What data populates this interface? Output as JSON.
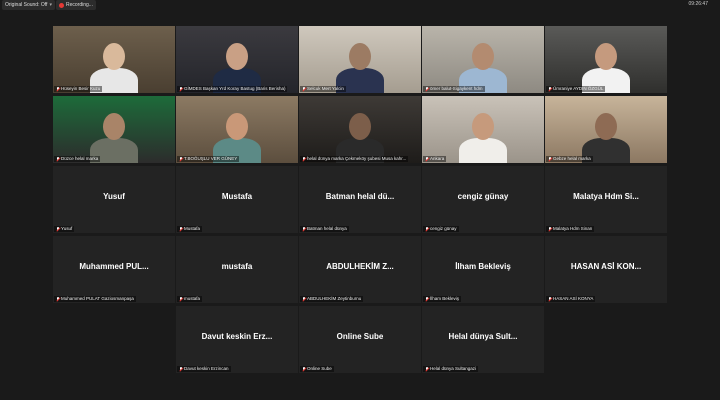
{
  "topbar": {
    "sound_label": "Original Sound: Off",
    "recording_label": "Recording...",
    "clock": "09:26:47"
  },
  "tiles": [
    {
      "label": "Hüseyin Besir Kuzu",
      "name": "",
      "video": true,
      "scene": "office",
      "active": true
    },
    {
      "label": "GİMDES Başkan Yrd Koray Bastug (Baris Berisha)",
      "name": "",
      "video": true,
      "scene": "suit"
    },
    {
      "label": "Selcuk Mert Yalcin",
      "name": "",
      "video": true,
      "scene": "cap"
    },
    {
      "label": "ömer balut-Sigaykent hdm",
      "name": "",
      "video": true,
      "scene": "beard"
    },
    {
      "label": "Ümraniye AYDIN ÖZGÜL",
      "name": "",
      "video": true,
      "scene": "car"
    },
    {
      "label": "Düzce helal marka",
      "name": "",
      "video": true,
      "scene": "green"
    },
    {
      "label": "T.BOĞUŞLU VER GÜNEY",
      "name": "",
      "video": true,
      "scene": "shop"
    },
    {
      "label": "helal dünya marka Çekmeköy şubesi Musa kahr...",
      "name": "",
      "video": true,
      "scene": "dark"
    },
    {
      "label": "Ankara",
      "name": "",
      "video": true,
      "scene": "glasses"
    },
    {
      "label": "Gebze helal marka",
      "name": "",
      "video": true,
      "scene": "kitchen"
    },
    {
      "label": "Yusuf",
      "name": "Yusuf",
      "video": false
    },
    {
      "label": "Mustafa",
      "name": "Mustafa",
      "video": false
    },
    {
      "label": "Batman helal dünya",
      "name": "Batman helal dü...",
      "video": false
    },
    {
      "label": "cengiz günay",
      "name": "cengiz günay",
      "video": false
    },
    {
      "label": "Malatya Hdm Sinan",
      "name": "Malatya Hdm Si...",
      "video": false
    },
    {
      "label": "Muhammed PULAT Gaziosmanpaşa",
      "name": "Muhammed PUL...",
      "video": false
    },
    {
      "label": "mustafa",
      "name": "mustafa",
      "video": false
    },
    {
      "label": "ABDULHEKİM Zeytinburnu",
      "name": "ABDULHEKİM Z...",
      "video": false
    },
    {
      "label": "İlham Bekleviş",
      "name": "İlham Bekleviş",
      "video": false
    },
    {
      "label": "HASAN ASİ KONYA",
      "name": "HASAN ASİ KON...",
      "video": false
    },
    {
      "label": "Davut keskin Erzincan",
      "name": "Davut keskin Erz...",
      "video": false
    },
    {
      "label": "Online Sube",
      "name": "Online Sube",
      "video": false
    },
    {
      "label": "Helal dünya Sultangazi",
      "name": "Helal dünya Sult...",
      "video": false
    }
  ]
}
